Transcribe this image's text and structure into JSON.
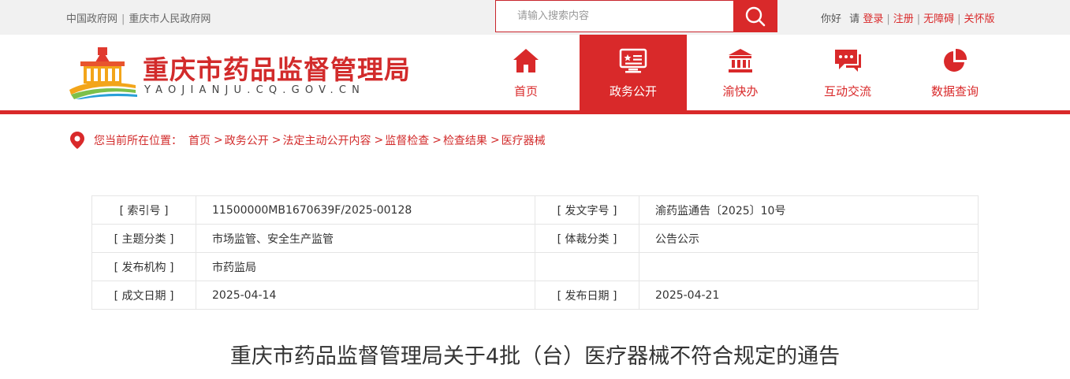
{
  "topbar": {
    "links": [
      "中国政府网",
      "重庆市人民政府网"
    ],
    "search_placeholder": "请输入搜索内容",
    "greeting": "你好",
    "please": "请",
    "login": "登录",
    "register": "注册",
    "accessible": "无障碍",
    "care": "关怀版"
  },
  "header": {
    "site_name": "重庆市药品监督管理局",
    "site_domain": "YAOJIANJU.CQ.GOV.CN"
  },
  "nav": [
    {
      "label": "首页",
      "icon": "home-icon"
    },
    {
      "label": "政务公开",
      "icon": "monitor-star-icon",
      "active": true
    },
    {
      "label": "渝快办",
      "icon": "building-icon"
    },
    {
      "label": "互动交流",
      "icon": "chat-icon"
    },
    {
      "label": "数据查询",
      "icon": "pie-chart-icon"
    }
  ],
  "breadcrumb": {
    "label": "您当前所在位置：",
    "items": [
      "首页",
      "政务公开",
      "法定主动公开内容",
      "监督检查",
      "检查结果",
      "医疗器械"
    ]
  },
  "info": {
    "rows": [
      {
        "k1": "[ 索引号 ]",
        "v1": "11500000MB1670639F/2025-00128",
        "k2": "[ 发文字号 ]",
        "v2": "渝药监通告〔2025〕10号"
      },
      {
        "k1": "[ 主题分类 ]",
        "v1": "市场监管、安全生产监管",
        "k2": "[ 体裁分类 ]",
        "v2": "公告公示"
      },
      {
        "k1": "[ 发布机构 ]",
        "v1": "市药监局",
        "k2": "",
        "v2": ""
      },
      {
        "k1": "[ 成文日期 ]",
        "v1": "2025-04-14",
        "k2": "[ 发布日期 ]",
        "v2": "2025-04-21"
      }
    ]
  },
  "document": {
    "title": "重庆市药品监督管理局关于4批（台）医疗器械不符合规定的通告"
  },
  "colors": {
    "brand_red": "#d9292a",
    "title_red": "#d22b2b",
    "topbar_bg": "#f1f1f1"
  }
}
